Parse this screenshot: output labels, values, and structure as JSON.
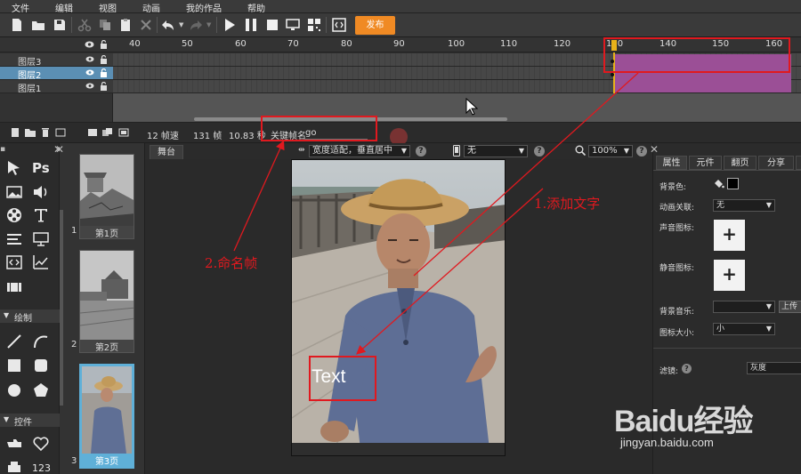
{
  "menubar": {
    "items": [
      "文件",
      "编辑",
      "视图",
      "动画",
      "我的作品",
      "帮助"
    ]
  },
  "toolbar": {
    "publish_label": "发布"
  },
  "timeline": {
    "ticks": [
      "40",
      "50",
      "60",
      "70",
      "80",
      "90",
      "100",
      "110",
      "120",
      "130",
      "140",
      "150",
      "160"
    ],
    "layers": [
      "图层3",
      "图层2",
      "图层1"
    ],
    "selected_layer": "图层2"
  },
  "status": {
    "fps": "12 帧速",
    "frames": "131 帧",
    "duration": "10.83 秒",
    "keyframe_label": "关键帧名",
    "keyframe_value": "go"
  },
  "tools": {
    "ps_label": "Ps",
    "draw_section": "绘制",
    "controls_section": "控件",
    "number_label": "123"
  },
  "pages": [
    {
      "num": "1",
      "label": "第1页"
    },
    {
      "num": "2",
      "label": "第2页"
    },
    {
      "num": "3",
      "label": "第3页"
    }
  ],
  "stage": {
    "tab": "舞台",
    "fit_mode": "宽度适配，垂直居中",
    "device": "无",
    "zoom": "100%",
    "canvas_text": "Text"
  },
  "properties": {
    "tabs": [
      "属性",
      "元件",
      "翻页",
      "分享"
    ],
    "bg_color_label": "背景色:",
    "bg_color": "#000000",
    "anim_link_label": "动画关联:",
    "anim_link_value": "无",
    "sound_icon_label": "声音图标:",
    "mute_icon_label": "静音图标:",
    "bg_music_label": "背景音乐:",
    "upload_label": "上传",
    "icon_size_label": "图标大小:",
    "icon_size_value": "小",
    "filter_label": "滤镜:",
    "filter_value": "灰度"
  },
  "annotations": {
    "step1": "1.添加文字",
    "step2": "2.命名帧"
  },
  "watermark": {
    "brand": "Baidu经验",
    "url": "jingyan.baidu.com"
  },
  "colors": {
    "accent_orange": "#f08a24",
    "annotation_red": "#e0191f",
    "selected_layer_bg": "#5b8fb4",
    "selected_page_border": "#5fb0d8",
    "keyframe_purple": "#9b4f96"
  }
}
